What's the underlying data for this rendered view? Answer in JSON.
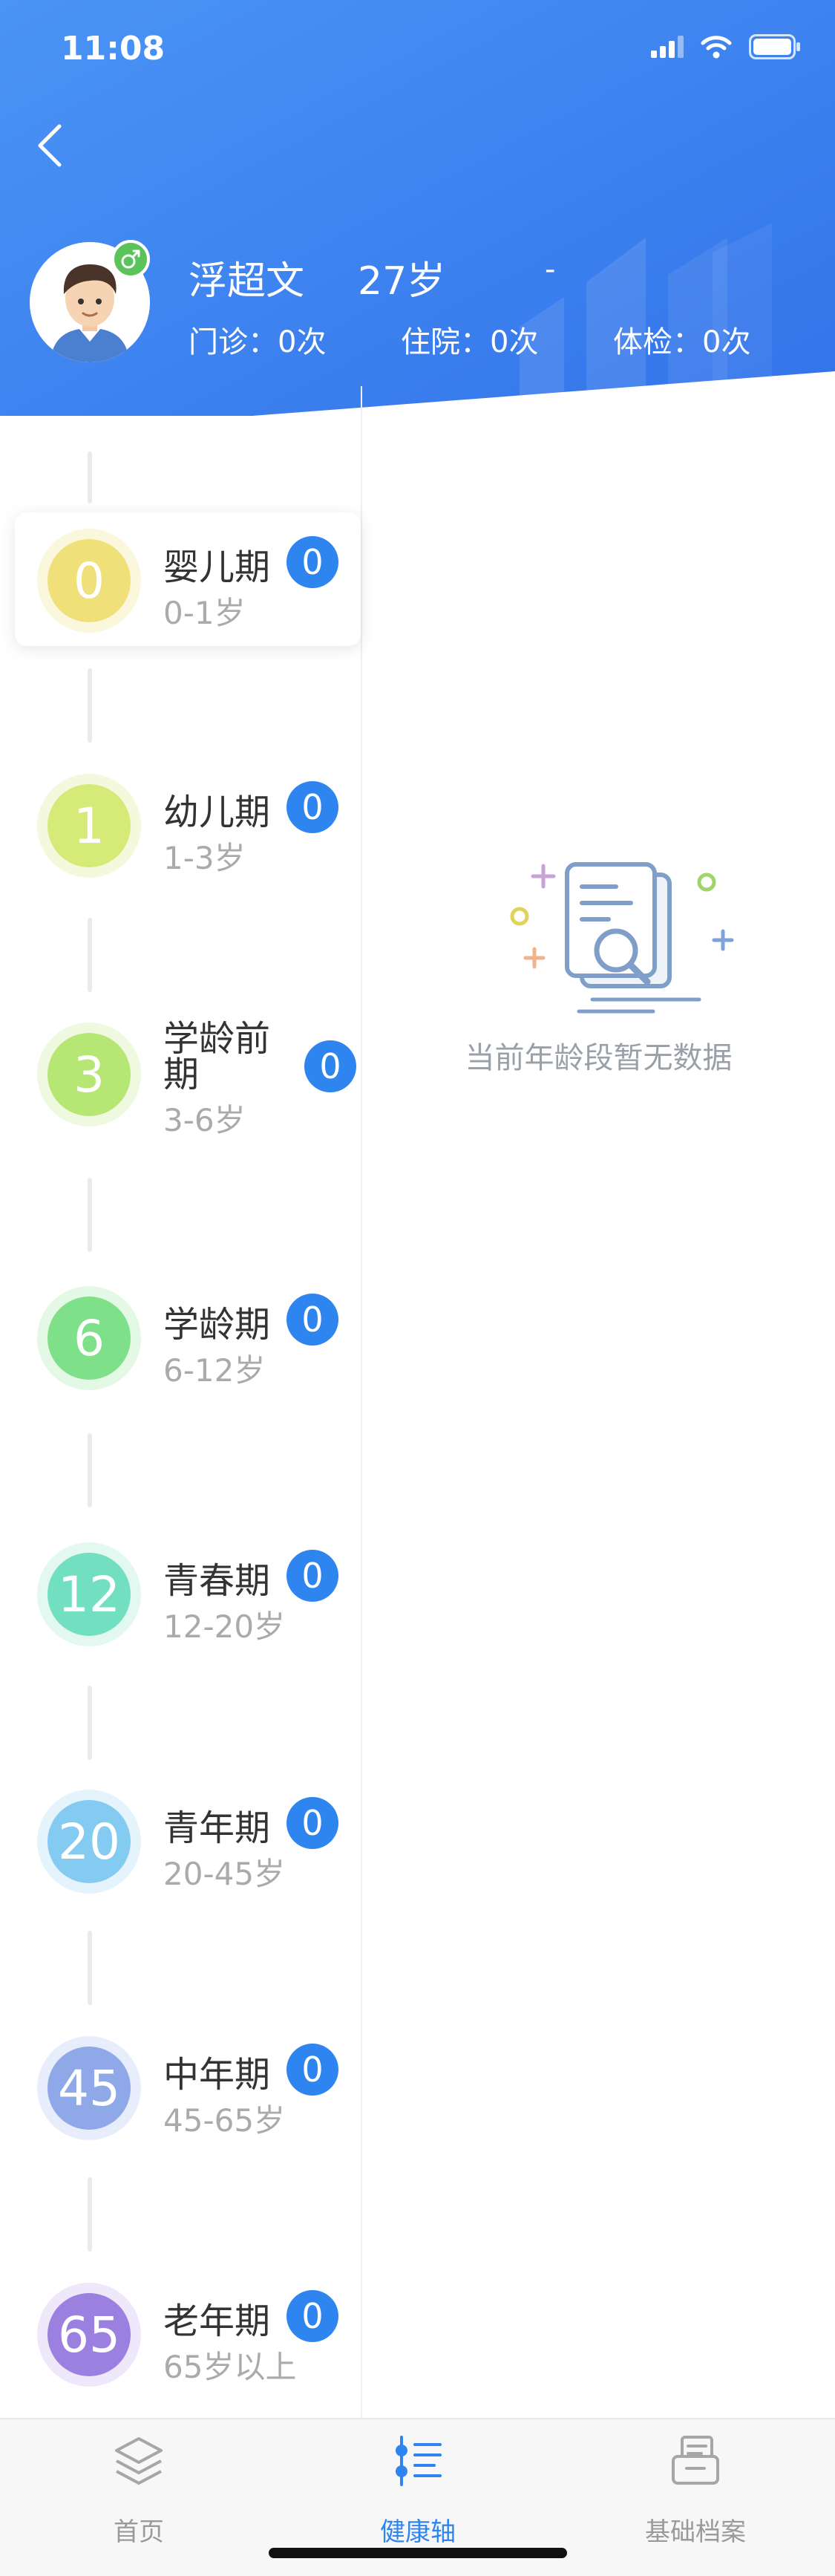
{
  "status_bar": {
    "time": "11:08"
  },
  "user": {
    "name": "浮超文",
    "age": "27岁",
    "extra": "-",
    "stats": {
      "outpatient": "门诊：0次",
      "inpatient": "住院：0次",
      "checkup": "体检：0次"
    }
  },
  "stages": [
    {
      "number": "0",
      "title": "婴儿期",
      "range": "0-1岁",
      "count": "0",
      "color": "#f0e07a",
      "ring": "#fbf7dc"
    },
    {
      "number": "1",
      "title": "幼儿期",
      "range": "1-3岁",
      "count": "0",
      "color": "#d6ea78",
      "ring": "#f4f9dd"
    },
    {
      "number": "3",
      "title": "学龄前期",
      "range": "3-6岁",
      "count": "0",
      "color": "#b6e674",
      "ring": "#eef9df"
    },
    {
      "number": "6",
      "title": "学龄期",
      "range": "6-12岁",
      "count": "0",
      "color": "#7fe08a",
      "ring": "#e4f8e6"
    },
    {
      "number": "12",
      "title": "青春期",
      "range": "12-20岁",
      "count": "0",
      "color": "#72e0c0",
      "ring": "#e2f8f1"
    },
    {
      "number": "20",
      "title": "青年期",
      "range": "20-45岁",
      "count": "0",
      "color": "#84cbf2",
      "ring": "#e4f3fc"
    },
    {
      "number": "45",
      "title": "中年期",
      "range": "45-65岁",
      "count": "0",
      "color": "#8ea8e8",
      "ring": "#e7edfa"
    },
    {
      "number": "65",
      "title": "老年期",
      "range": "65岁以上",
      "count": "0",
      "color": "#9c80e0",
      "ring": "#eee8fa"
    }
  ],
  "empty_state": {
    "text": "当前年龄段暂无数据"
  },
  "tabs": [
    {
      "label": "首页",
      "icon": "layers-icon",
      "active": false
    },
    {
      "label": "健康轴",
      "icon": "timeline-list-icon",
      "active": true
    },
    {
      "label": "基础档案",
      "icon": "folder-archive-icon",
      "active": false
    }
  ],
  "colors": {
    "header_blue": "#3f8ef3",
    "accent": "#2f85ef"
  }
}
